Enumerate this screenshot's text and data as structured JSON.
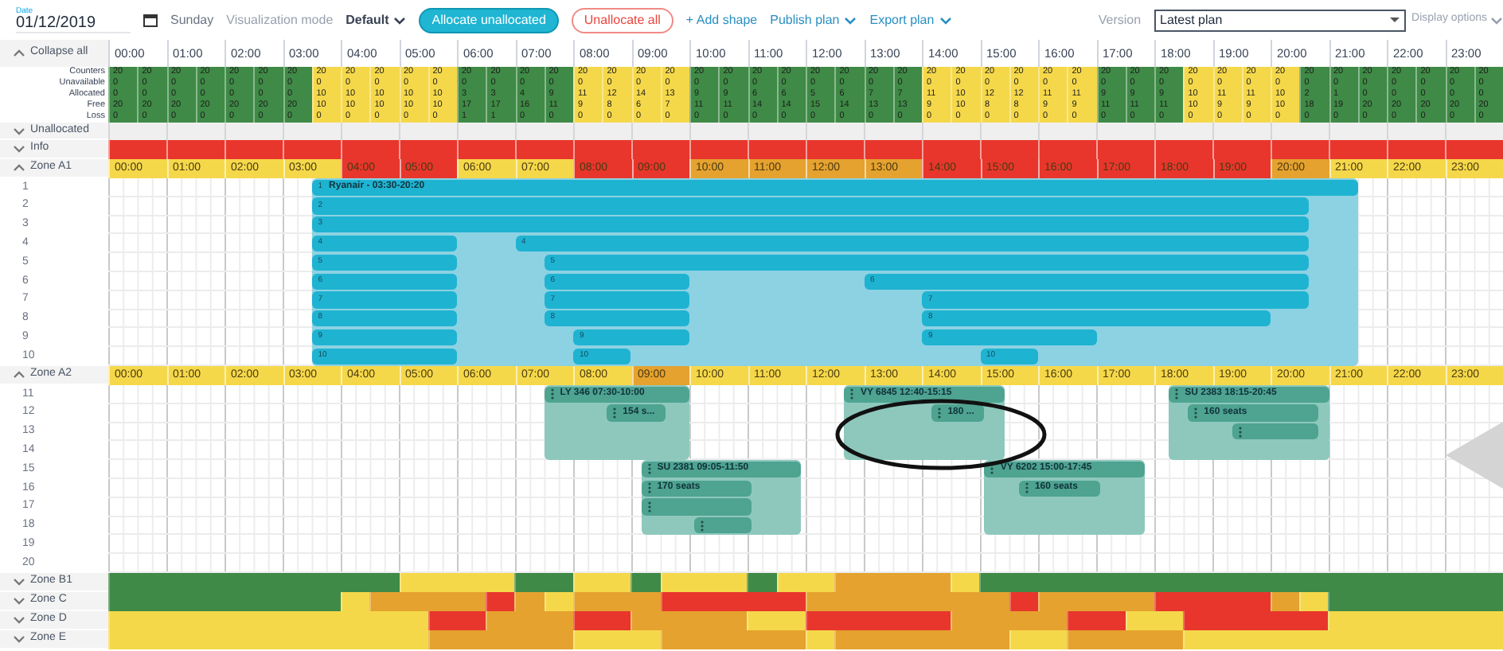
{
  "toolbar": {
    "date_label": "Date",
    "date": "01/12/2019",
    "day": "Sunday",
    "mode_label": "Visualization mode",
    "mode": "Default",
    "allocate_button": "Allocate unallocated",
    "unallocate_button": "Unallocate all",
    "add_shape": "+ Add shape",
    "publish": "Publish plan",
    "export": "Export plan",
    "version_label": "Version",
    "version": "Latest plan",
    "display_options": "Display options"
  },
  "timeline": {
    "collapse_label": "Collapse all",
    "expanded": true,
    "hours": [
      "00:00",
      "01:00",
      "02:00",
      "03:00",
      "04:00",
      "05:00",
      "06:00",
      "07:00",
      "08:00",
      "09:00",
      "10:00",
      "11:00",
      "12:00",
      "13:00",
      "14:00",
      "15:00",
      "16:00",
      "17:00",
      "18:00",
      "19:00",
      "20:00",
      "21:00",
      "22:00",
      "23:00"
    ]
  },
  "counts": {
    "labels": [
      "Counters",
      "Unavailable",
      "Allocated",
      "Free",
      "Loss"
    ],
    "cells": [
      {
        "values": [
          "20",
          "0",
          "0",
          "20",
          "0"
        ],
        "color": "#3f8a46"
      },
      {
        "values": [
          "20",
          "0",
          "0",
          "20",
          "0"
        ],
        "color": "#3f8a46"
      },
      {
        "values": [
          "20",
          "0",
          "0",
          "20",
          "0"
        ],
        "color": "#3f8a46"
      },
      {
        "values": [
          "20",
          "0",
          "0",
          "20",
          "0"
        ],
        "color": "#3f8a46"
      },
      {
        "values": [
          "20",
          "0",
          "0",
          "20",
          "0"
        ],
        "color": "#3f8a46"
      },
      {
        "values": [
          "20",
          "0",
          "0",
          "20",
          "0"
        ],
        "color": "#3f8a46"
      },
      {
        "values": [
          "20",
          "0",
          "0",
          "20",
          "0"
        ],
        "color": "#3f8a46"
      },
      {
        "values": [
          "20",
          "0",
          "10",
          "10",
          "0"
        ],
        "color": "#f5d84a"
      },
      {
        "values": [
          "20",
          "0",
          "10",
          "10",
          "0"
        ],
        "color": "#f5d84a"
      },
      {
        "values": [
          "20",
          "0",
          "10",
          "10",
          "0"
        ],
        "color": "#f5d84a"
      },
      {
        "values": [
          "20",
          "0",
          "10",
          "10",
          "0"
        ],
        "color": "#f5d84a"
      },
      {
        "values": [
          "20",
          "0",
          "10",
          "10",
          "0"
        ],
        "color": "#f5d84a"
      },
      {
        "values": [
          "20",
          "0",
          "3",
          "17",
          "1"
        ],
        "color": "#3f8a46"
      },
      {
        "values": [
          "20",
          "0",
          "3",
          "17",
          "1"
        ],
        "color": "#3f8a46"
      },
      {
        "values": [
          "20",
          "0",
          "4",
          "16",
          "0"
        ],
        "color": "#3f8a46"
      },
      {
        "values": [
          "20",
          "0",
          "9",
          "11",
          "0"
        ],
        "color": "#3f8a46"
      },
      {
        "values": [
          "20",
          "0",
          "11",
          "9",
          "0"
        ],
        "color": "#f5d84a"
      },
      {
        "values": [
          "20",
          "0",
          "12",
          "8",
          "0"
        ],
        "color": "#f5d84a"
      },
      {
        "values": [
          "20",
          "0",
          "14",
          "6",
          "0"
        ],
        "color": "#f5d84a"
      },
      {
        "values": [
          "20",
          "0",
          "13",
          "7",
          "0"
        ],
        "color": "#f5d84a"
      },
      {
        "values": [
          "20",
          "0",
          "9",
          "11",
          "0"
        ],
        "color": "#3f8a46"
      },
      {
        "values": [
          "20",
          "0",
          "9",
          "11",
          "0"
        ],
        "color": "#3f8a46"
      },
      {
        "values": [
          "20",
          "0",
          "6",
          "14",
          "0"
        ],
        "color": "#3f8a46"
      },
      {
        "values": [
          "20",
          "0",
          "6",
          "14",
          "0"
        ],
        "color": "#3f8a46"
      },
      {
        "values": [
          "20",
          "0",
          "5",
          "15",
          "0"
        ],
        "color": "#3f8a46"
      },
      {
        "values": [
          "20",
          "0",
          "6",
          "14",
          "0"
        ],
        "color": "#3f8a46"
      },
      {
        "values": [
          "20",
          "0",
          "7",
          "13",
          "0"
        ],
        "color": "#3f8a46"
      },
      {
        "values": [
          "20",
          "0",
          "7",
          "13",
          "0"
        ],
        "color": "#3f8a46"
      },
      {
        "values": [
          "20",
          "0",
          "11",
          "9",
          "0"
        ],
        "color": "#f5d84a"
      },
      {
        "values": [
          "20",
          "0",
          "10",
          "10",
          "0"
        ],
        "color": "#f5d84a"
      },
      {
        "values": [
          "20",
          "0",
          "12",
          "8",
          "0"
        ],
        "color": "#f5d84a"
      },
      {
        "values": [
          "20",
          "0",
          "12",
          "8",
          "0"
        ],
        "color": "#f5d84a"
      },
      {
        "values": [
          "20",
          "0",
          "11",
          "9",
          "0"
        ],
        "color": "#f5d84a"
      },
      {
        "values": [
          "20",
          "0",
          "11",
          "9",
          "0"
        ],
        "color": "#f5d84a"
      },
      {
        "values": [
          "20",
          "0",
          "9",
          "11",
          "0"
        ],
        "color": "#3f8a46"
      },
      {
        "values": [
          "20",
          "0",
          "9",
          "11",
          "0"
        ],
        "color": "#3f8a46"
      },
      {
        "values": [
          "20",
          "0",
          "9",
          "11",
          "0"
        ],
        "color": "#3f8a46"
      },
      {
        "values": [
          "20",
          "0",
          "10",
          "10",
          "0"
        ],
        "color": "#f5d84a"
      },
      {
        "values": [
          "20",
          "0",
          "11",
          "9",
          "0"
        ],
        "color": "#f5d84a"
      },
      {
        "values": [
          "20",
          "0",
          "11",
          "9",
          "0"
        ],
        "color": "#f5d84a"
      },
      {
        "values": [
          "20",
          "0",
          "10",
          "10",
          "0"
        ],
        "color": "#f5d84a"
      },
      {
        "values": [
          "20",
          "0",
          "2",
          "18",
          "0"
        ],
        "color": "#3f8a46"
      },
      {
        "values": [
          "20",
          "0",
          "1",
          "19",
          "0"
        ],
        "color": "#3f8a46"
      },
      {
        "values": [
          "20",
          "0",
          "0",
          "20",
          "0"
        ],
        "color": "#3f8a46"
      },
      {
        "values": [
          "20",
          "0",
          "0",
          "20",
          "0"
        ],
        "color": "#3f8a46"
      },
      {
        "values": [
          "20",
          "0",
          "0",
          "20",
          "0"
        ],
        "color": "#3f8a46"
      },
      {
        "values": [
          "20",
          "0",
          "0",
          "20",
          "0"
        ],
        "color": "#3f8a46"
      },
      {
        "values": [
          "20",
          "0",
          "0",
          "20",
          "0"
        ],
        "color": "#3f8a46"
      }
    ]
  },
  "unallocated": {
    "label": "Unallocated",
    "expanded": false
  },
  "info": {
    "label": "Info",
    "expanded": false,
    "color": "#e8362c"
  },
  "zones": [
    {
      "label": "Zone A1",
      "expanded": true,
      "kind": "airline",
      "hours": [
        {
          "label": "00:00",
          "color": "#f5d84a"
        },
        {
          "label": "01:00",
          "color": "#f5d84a"
        },
        {
          "label": "02:00",
          "color": "#f5d84a"
        },
        {
          "label": "03:00",
          "color": "#f5d84a"
        },
        {
          "label": "04:00",
          "color": "#e8362c"
        },
        {
          "label": "05:00",
          "color": "#e8362c"
        },
        {
          "label": "06:00",
          "color": "#f5d84a"
        },
        {
          "label": "07:00",
          "color": "#f5d84a"
        },
        {
          "label": "08:00",
          "color": "#e8362c"
        },
        {
          "label": "09:00",
          "color": "#e8362c"
        },
        {
          "label": "10:00",
          "color": "#e5a22f"
        },
        {
          "label": "11:00",
          "color": "#e5a22f"
        },
        {
          "label": "12:00",
          "color": "#e5a22f"
        },
        {
          "label": "13:00",
          "color": "#e5a22f"
        },
        {
          "label": "14:00",
          "color": "#e8362c"
        },
        {
          "label": "15:00",
          "color": "#e8362c"
        },
        {
          "label": "16:00",
          "color": "#e8362c"
        },
        {
          "label": "17:00",
          "color": "#e8362c"
        },
        {
          "label": "18:00",
          "color": "#e8362c"
        },
        {
          "label": "19:00",
          "color": "#e8362c"
        },
        {
          "label": "20:00",
          "color": "#e5a22f"
        },
        {
          "label": "21:00",
          "color": "#f5d84a"
        },
        {
          "label": "22:00",
          "color": "#f5d84a"
        },
        {
          "label": "23:00",
          "color": "#f5d84a"
        }
      ],
      "rows": [
        {
          "label": "1",
          "blocks": [
            {
              "rows": [
                {
                  "segments": [
                    {
                      "marker": "1",
                      "text": "Ryanair - 03:30-20:20"
                    }
                  ]
                },
                {
                  "segments": [
                    {
                      "marker": "2"
                    }
                  ]
                },
                {
                  "segments": [
                    {
                      "marker": "3"
                    }
                  ]
                },
                {
                  "segments": [
                    {
                      "marker": "4"
                    },
                    {
                      "marker": "4"
                    }
                  ]
                },
                {
                  "segments": [
                    {
                      "marker": "5"
                    },
                    {
                      "marker": "5"
                    }
                  ]
                },
                {
                  "segments": [
                    {
                      "marker": "6"
                    },
                    {
                      "marker": "6"
                    },
                    {
                      "marker": "6"
                    }
                  ]
                },
                {
                  "segments": [
                    {
                      "marker": "7"
                    },
                    {
                      "marker": "7"
                    },
                    {
                      "marker": "7"
                    }
                  ]
                },
                {
                  "segments": [
                    {
                      "marker": "8"
                    },
                    {
                      "marker": "8"
                    },
                    {
                      "marker": "8"
                    }
                  ]
                },
                {
                  "segments": [
                    {
                      "marker": "9"
                    },
                    {
                      "marker": "9"
                    },
                    {
                      "marker": "9"
                    }
                  ]
                },
                {
                  "segments": [
                    {
                      "marker": "10"
                    },
                    {
                      "marker": "10"
                    },
                    {
                      "marker": "10"
                    }
                  ]
                }
              ]
            }
          ]
        },
        {
          "label": "2"
        },
        {
          "label": "3"
        },
        {
          "label": "4"
        },
        {
          "label": "5"
        },
        {
          "label": "6"
        },
        {
          "label": "7"
        },
        {
          "label": "8"
        },
        {
          "label": "9"
        },
        {
          "label": "10"
        }
      ]
    },
    {
      "label": "Zone A2",
      "expanded": true,
      "kind": "flight",
      "hours": [
        {
          "label": "00:00",
          "color": "#f5d84a"
        },
        {
          "label": "01:00",
          "color": "#f5d84a"
        },
        {
          "label": "02:00",
          "color": "#f5d84a"
        },
        {
          "label": "03:00",
          "color": "#f5d84a"
        },
        {
          "label": "04:00",
          "color": "#f5d84a"
        },
        {
          "label": "05:00",
          "color": "#f5d84a"
        },
        {
          "label": "06:00",
          "color": "#f5d84a"
        },
        {
          "label": "07:00",
          "color": "#f5d84a"
        },
        {
          "label": "08:00",
          "color": "#f5d84a"
        },
        {
          "label": "09:00",
          "color": "#e5a22f"
        },
        {
          "label": "10:00",
          "color": "#f5d84a"
        },
        {
          "label": "11:00",
          "color": "#f5d84a"
        },
        {
          "label": "12:00",
          "color": "#f5d84a"
        },
        {
          "label": "13:00",
          "color": "#f5d84a"
        },
        {
          "label": "14:00",
          "color": "#f5d84a"
        },
        {
          "label": "15:00",
          "color": "#f5d84a"
        },
        {
          "label": "16:00",
          "color": "#f5d84a"
        },
        {
          "label": "17:00",
          "color": "#f5d84a"
        },
        {
          "label": "18:00",
          "color": "#f5d84a"
        },
        {
          "label": "19:00",
          "color": "#f5d84a"
        },
        {
          "label": "20:00",
          "color": "#f5d84a"
        },
        {
          "label": "21:00",
          "color": "#f5d84a"
        },
        {
          "label": "22:00",
          "color": "#f5d84a"
        },
        {
          "label": "23:00",
          "color": "#f5d84a"
        }
      ],
      "rows": [
        {
          "label": "11",
          "blocks": [
            {
              "rows": [
                {
                  "segments": [
                    {
                      "grip": true,
                      "text": "LY 346 07:30-10:00"
                    }
                  ]
                },
                {
                  "segments": [
                    {
                      "grip": true,
                      "text": "154 s..."
                    }
                  ]
                }
              ]
            },
            {
              "rows": [
                {
                  "segments": [
                    {
                      "grip": true,
                      "text": "VY 6845 12:40-15:15"
                    }
                  ]
                },
                {
                  "segments": [
                    {
                      "grip": true,
                      "text": "180 ..."
                    }
                  ]
                }
              ]
            },
            {
              "rows": [
                {
                  "segments": [
                    {
                      "grip": true,
                      "text": "SU 2383 18:15-20:45"
                    }
                  ]
                },
                {
                  "segments": [
                    {
                      "grip": true,
                      "text": "160 seats"
                    }
                  ]
                },
                {
                  "segments": [
                    {
                      "grip": true
                    }
                  ]
                }
              ]
            }
          ]
        },
        {
          "label": "12"
        },
        {
          "label": "13"
        },
        {
          "label": "14"
        },
        {
          "label": "15",
          "blocks": [
            {
              "rows": [
                {
                  "segments": [
                    {
                      "grip": true,
                      "text": "SU 2381 09:05-11:50"
                    }
                  ]
                },
                {
                  "segments": [
                    {
                      "grip": true,
                      "text": "170 seats"
                    }
                  ]
                },
                {
                  "segments": [
                    {
                      "grip": true
                    }
                  ]
                },
                {
                  "segments": [
                    {
                      "grip": true
                    }
                  ]
                }
              ]
            },
            {
              "rows": [
                {
                  "segments": [
                    {
                      "grip": true,
                      "text": "VY 6202 15:00-17:45"
                    }
                  ]
                },
                {
                  "segments": [
                    {
                      "grip": true,
                      "text": "160 seats"
                    }
                  ]
                }
              ]
            }
          ]
        },
        {
          "label": "16"
        },
        {
          "label": "17"
        },
        {
          "label": "18"
        },
        {
          "label": "19"
        },
        {
          "label": "20"
        }
      ]
    }
  ],
  "heat_zones": [
    {
      "label": "Zone B1",
      "expanded": false,
      "segments": [
        {
          "color": "#3f8a46"
        },
        {
          "color": "#f5d84a"
        },
        {
          "color": "#3f8a46"
        },
        {
          "color": "#f5d84a"
        },
        {
          "color": "#3f8a46"
        },
        {
          "color": "#f5d84a"
        },
        {
          "color": "#3f8a46"
        },
        {
          "color": "#f5d84a"
        },
        {
          "color": "#e5a22f"
        },
        {
          "color": "#f5d84a"
        },
        {
          "color": "#3f8a46"
        }
      ]
    },
    {
      "label": "Zone C",
      "expanded": false,
      "segments": [
        {
          "color": "#3f8a46"
        },
        {
          "color": "#f5d84a"
        },
        {
          "color": "#e5a22f"
        },
        {
          "color": "#e8362c"
        },
        {
          "color": "#e5a22f"
        },
        {
          "color": "#f5d84a"
        },
        {
          "color": "#e5a22f"
        },
        {
          "color": "#e8362c"
        },
        {
          "color": "#e5a22f"
        },
        {
          "color": "#e8362c"
        },
        {
          "color": "#e5a22f"
        },
        {
          "color": "#e8362c"
        },
        {
          "color": "#e5a22f"
        },
        {
          "color": "#f5d84a"
        },
        {
          "color": "#3f8a46"
        }
      ]
    },
    {
      "label": "Zone D",
      "expanded": false,
      "segments": [
        {
          "color": "#f5d84a"
        },
        {
          "color": "#e8362c"
        },
        {
          "color": "#e5a22f"
        },
        {
          "color": "#e8362c"
        },
        {
          "color": "#e5a22f"
        },
        {
          "color": "#f5d84a"
        },
        {
          "color": "#e8362c"
        },
        {
          "color": "#e5a22f"
        },
        {
          "color": "#e8362c"
        },
        {
          "color": "#f5d84a"
        },
        {
          "color": "#e8362c"
        },
        {
          "color": "#f5d84a"
        }
      ]
    },
    {
      "label": "Zone E",
      "expanded": false,
      "segments": [
        {
          "color": "#f5d84a"
        },
        {
          "color": "#e5a22f"
        },
        {
          "color": "#f5d84a"
        },
        {
          "color": "#e5a22f"
        },
        {
          "color": "#f5d84a"
        },
        {
          "color": "#e5a22f"
        },
        {
          "color": "#f5d84a"
        },
        {
          "color": "#e5a22f"
        },
        {
          "color": "#f5d84a"
        }
      ]
    }
  ]
}
